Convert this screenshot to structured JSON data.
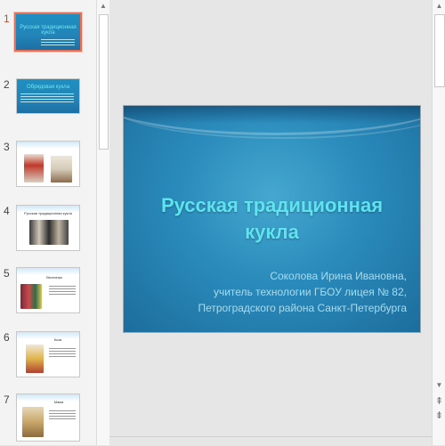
{
  "thumbnails": [
    {
      "num": "1",
      "title": "Русская традиционная кукла"
    },
    {
      "num": "2",
      "title": "Обрядовая кукла"
    },
    {
      "num": "3",
      "title": ""
    },
    {
      "num": "4",
      "title": "Русская традиционная кукла"
    },
    {
      "num": "5",
      "title": "Веснянка"
    },
    {
      "num": "6",
      "title": "Коза"
    },
    {
      "num": "7",
      "title": "Мама"
    }
  ],
  "slide": {
    "title": "Русская традиционная кукла",
    "subtitle_line1": "Соколова Ирина Ивановна,",
    "subtitle_line2": "учитель технологии ГБОУ лицея № 82,",
    "subtitle_line3": "Петроградского района Санкт-Петербурга"
  },
  "icons": {
    "scroll_up": "▲",
    "scroll_down": "▼",
    "prev_slide": "⇞",
    "next_slide": "⇟"
  },
  "colors": {
    "selected_border": "#e86f55",
    "slide_title": "#5fe3ef",
    "slide_bg": "#2a8bbb"
  }
}
